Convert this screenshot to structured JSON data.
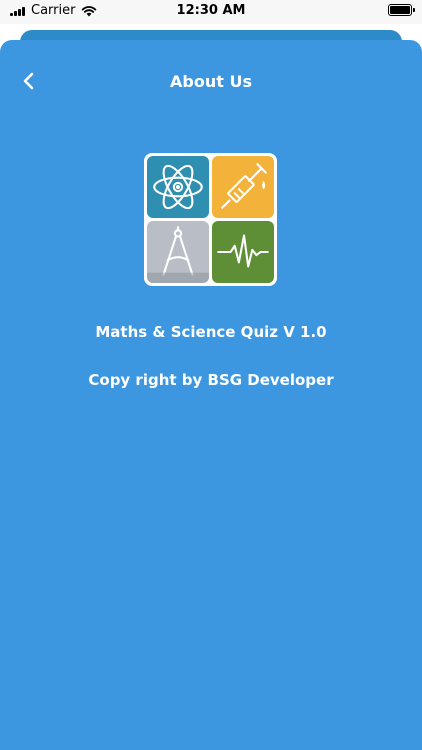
{
  "status_bar": {
    "carrier": "Carrier",
    "time": "12:30 AM",
    "icons": [
      "signal-icon",
      "wifi-icon",
      "battery-icon"
    ]
  },
  "header": {
    "title": "About Us",
    "back_icon": "chevron-left-icon"
  },
  "logo": {
    "tiles": [
      "atom-icon",
      "syringe-icon",
      "compass-icon",
      "heartbeat-wave-icon"
    ]
  },
  "content": {
    "app_version": "Maths & Science Quiz V 1.0",
    "copyright": "Copy right by BSG Developer"
  },
  "colors": {
    "background": "#3c97e0",
    "backdrop_sheet": "#2e8bc9",
    "text": "#ffffff"
  }
}
